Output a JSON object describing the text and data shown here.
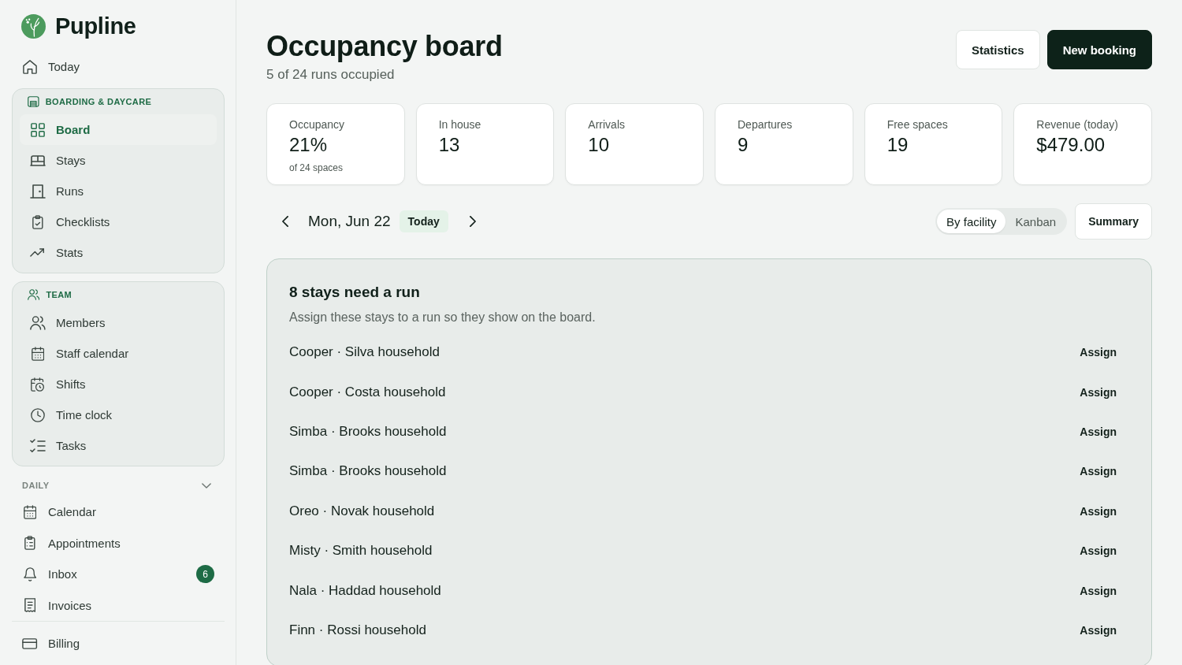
{
  "sidebar": {
    "brand": "Pupline",
    "top_items": [
      {
        "label": "Today",
        "selected": false
      }
    ],
    "groups": [
      {
        "title": "BOARDING & DAYCARE",
        "items": [
          {
            "label": "Board",
            "selected": true
          },
          {
            "label": "Stays",
            "selected": false
          },
          {
            "label": "Runs",
            "selected": false
          },
          {
            "label": "Checklists",
            "selected": false
          },
          {
            "label": "Stats",
            "selected": false
          }
        ]
      },
      {
        "title": "TEAM",
        "items": [
          {
            "label": "Members",
            "selected": false
          },
          {
            "label": "Staff calendar",
            "selected": false
          },
          {
            "label": "Shifts",
            "selected": false
          },
          {
            "label": "Time clock",
            "selected": false
          },
          {
            "label": "Tasks",
            "selected": false
          }
        ]
      }
    ],
    "daily": {
      "title": "DAILY",
      "expanded": true,
      "items": [
        {
          "label": "Calendar",
          "selected": false
        },
        {
          "label": "Appointments",
          "selected": false
        },
        {
          "label": "Inbox",
          "selected": false,
          "badge": "6"
        },
        {
          "label": "Invoices",
          "selected": false
        }
      ]
    },
    "bottom_items": [
      {
        "label": "Billing",
        "selected": false
      }
    ]
  },
  "header": {
    "title": "Occupancy board",
    "subtitle": "5 of 24 runs occupied",
    "buttons": [
      {
        "label": "Statistics",
        "kind": "secondary"
      },
      {
        "label": "New booking",
        "kind": "primary"
      }
    ]
  },
  "stats": [
    {
      "label": "Occupancy",
      "value": "21%",
      "note": "of 24 spaces"
    },
    {
      "label": "In house",
      "value": "13"
    },
    {
      "label": "Arrivals",
      "value": "10"
    },
    {
      "label": "Departures",
      "value": "9"
    },
    {
      "label": "Free spaces",
      "value": "19"
    },
    {
      "label": "Revenue (today)",
      "value": "$479.00"
    }
  ],
  "date_nav": {
    "date": "Mon, Jun 22",
    "today_button": "Today"
  },
  "view_tabs": [
    {
      "label": "By facility",
      "selected": true
    },
    {
      "label": "Kanban",
      "selected": false
    }
  ],
  "summary_button": "Summary",
  "unassigned": {
    "title": "8 stays need a run",
    "description": "Assign these stays to a run so they show on the board.",
    "rows": [
      {
        "stay": "Cooper · Silva household",
        "action": "Assign"
      },
      {
        "stay": "Cooper · Costa household",
        "action": "Assign"
      },
      {
        "stay": "Simba · Brooks household",
        "action": "Assign"
      },
      {
        "stay": "Simba · Brooks household",
        "action": "Assign"
      },
      {
        "stay": "Oreo · Novak household",
        "action": "Assign"
      },
      {
        "stay": "Misty · Smith household",
        "action": "Assign"
      },
      {
        "stay": "Nala · Haddad household",
        "action": "Assign"
      },
      {
        "stay": "Finn · Rossi household",
        "action": "Assign"
      }
    ]
  }
}
